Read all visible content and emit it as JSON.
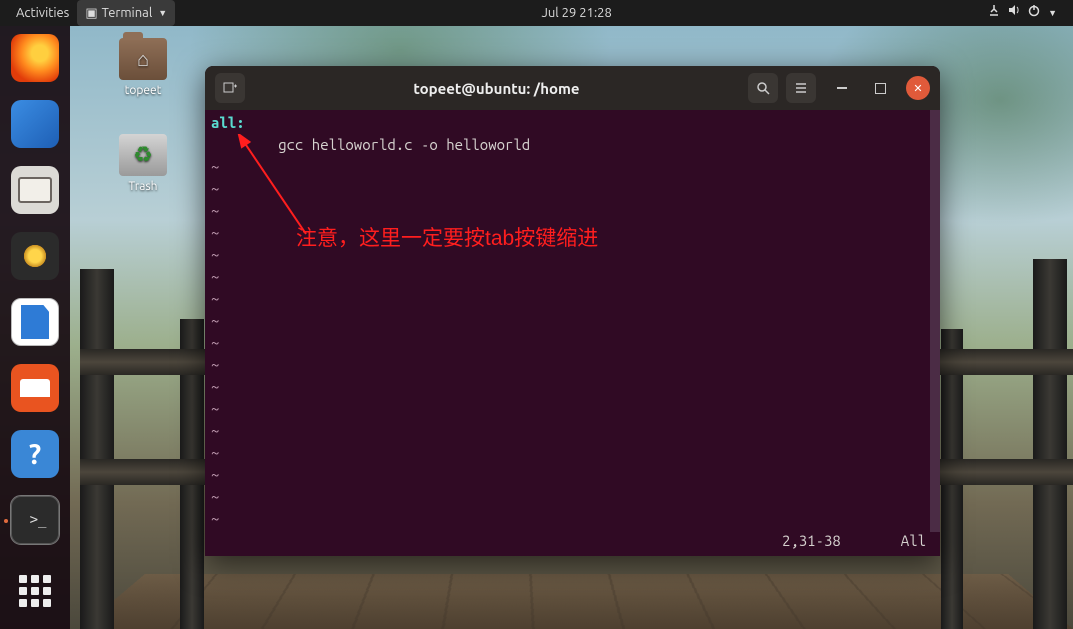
{
  "topbar": {
    "activities": "Activities",
    "app_menu": "Terminal",
    "clock": "Jul 29  21:28"
  },
  "desktop": {
    "home_label": "topeet",
    "trash_label": "Trash"
  },
  "dock": {
    "items": [
      "firefox",
      "thunderbird",
      "files",
      "rhythmbox",
      "libreoffice-writer",
      "ubuntu-software",
      "help",
      "terminal",
      "show-applications"
    ]
  },
  "terminal": {
    "title": "topeet@ubuntu: /home",
    "content": {
      "target": "all:",
      "command": "        gcc helloworld.c -o helloworld"
    },
    "status": {
      "pos": "2,31-38",
      "scroll": "All"
    }
  },
  "annotation": {
    "text": "注意，这里一定要按tab按键缩进"
  }
}
